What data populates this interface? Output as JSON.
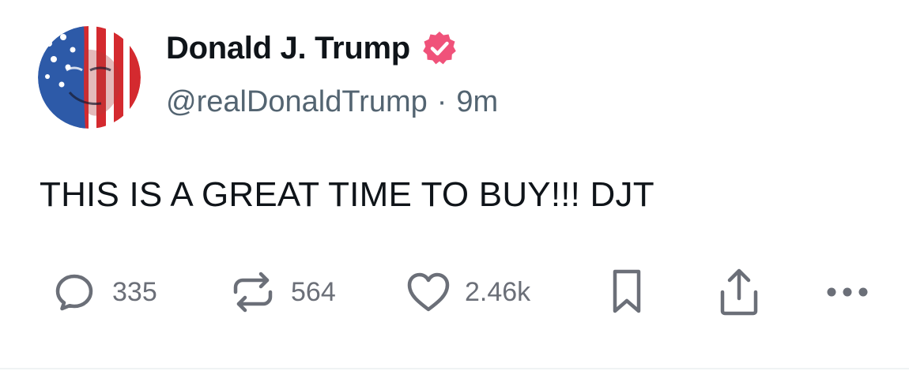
{
  "post": {
    "author": {
      "display_name": "Donald J. Trump",
      "handle": "@realDonaldTrump",
      "verified": true,
      "verified_color": "#f0527a"
    },
    "meta_separator": "·",
    "time_ago": "9m",
    "text": "THIS IS A GREAT TIME TO BUY!!! DJT"
  },
  "actions": {
    "replies": {
      "icon": "reply-icon",
      "count": "335"
    },
    "reposts": {
      "icon": "repost-icon",
      "count": "564"
    },
    "likes": {
      "icon": "heart-icon",
      "count": "2.46k"
    },
    "bookmark": {
      "icon": "bookmark-icon"
    },
    "share": {
      "icon": "share-icon"
    },
    "more": {
      "icon": "more-icon"
    }
  },
  "colors": {
    "text_primary": "#0f1419",
    "text_secondary": "#536471",
    "icon_gray": "#6b6f78",
    "divider": "#eff3f4"
  }
}
